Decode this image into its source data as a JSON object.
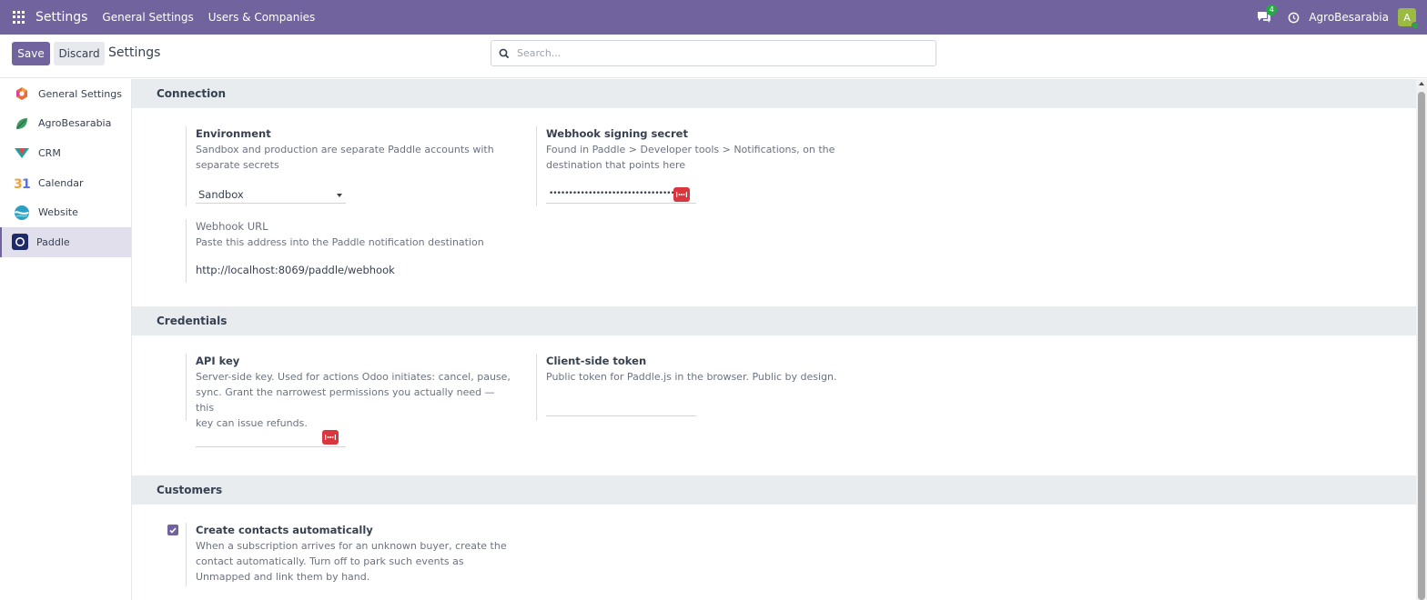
{
  "navbar": {
    "title": "Settings",
    "menu": [
      "General Settings",
      "Users & Companies"
    ],
    "chat_badge": "4",
    "company": "AgroBesarabia",
    "avatar_letter": "A"
  },
  "control_panel": {
    "save_label": "Save",
    "discard_label": "Discard",
    "title": "Settings",
    "search_placeholder": "Search..."
  },
  "sidebar": {
    "items": [
      {
        "label": "General Settings",
        "icon": "general-settings-icon"
      },
      {
        "label": "AgroBesarabia",
        "icon": "leaf-icon"
      },
      {
        "label": "CRM",
        "icon": "crm-icon"
      },
      {
        "label": "Calendar",
        "icon": "calendar-icon"
      },
      {
        "label": "Website",
        "icon": "website-icon"
      },
      {
        "label": "Paddle",
        "icon": "paddle-icon",
        "active": true
      }
    ]
  },
  "sections": {
    "connection": {
      "title": "Connection",
      "environment": {
        "title": "Environment",
        "desc1": "Sandbox and production are separate Paddle accounts with",
        "desc2": "separate secrets",
        "value": "Sandbox"
      },
      "webhook_secret": {
        "title": "Webhook signing secret",
        "desc1": "Found in Paddle > Developer tools > Notifications, on the",
        "desc2": "destination that points here",
        "value": "••••••••••••••••••••••••••••••••"
      },
      "webhook_url": {
        "title": "Webhook URL",
        "desc": "Paste this address into the Paddle notification destination",
        "value": "http://localhost:8069/paddle/webhook"
      }
    },
    "credentials": {
      "title": "Credentials",
      "api_key": {
        "title": "API key",
        "desc1": "Server-side key. Used for actions Odoo initiates: cancel, pause,",
        "desc2": "sync. Grant the narrowest permissions you actually need — this",
        "desc3": "key can issue refunds."
      },
      "client_token": {
        "title": "Client-side token",
        "desc": "Public token for Paddle.js in the browser. Public by design."
      }
    },
    "customers": {
      "title": "Customers",
      "create_contacts": {
        "title": "Create contacts automatically",
        "desc1": "When a subscription arrives for an unknown buyer, create the",
        "desc2": "contact automatically. Turn off to park such events as",
        "desc3": "Unmapped and link them by hand.",
        "checked": true
      }
    }
  },
  "colors": {
    "brand": "#71639e",
    "danger": "#d9363e",
    "section_bg": "#e9ecef"
  }
}
